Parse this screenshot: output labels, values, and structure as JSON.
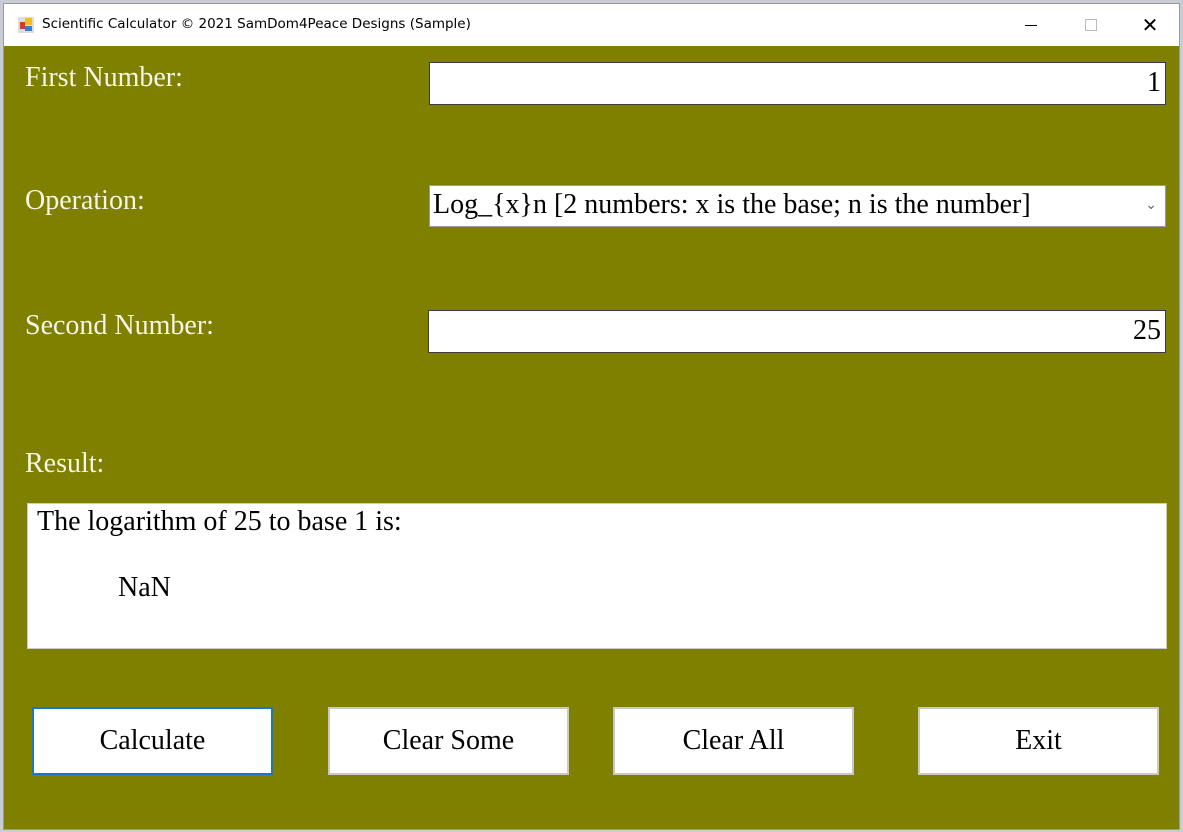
{
  "window": {
    "title": "Scientific Calculator © 2021 SamDom4Peace Designs (Sample)",
    "background": "#808000"
  },
  "form": {
    "first_label": "First Number:",
    "first_value": "1",
    "operation_label": "Operation:",
    "operation_value": "Log_{x}n [2 numbers: x is the base; n is the number]",
    "second_label": "Second Number:",
    "second_value": "25",
    "result_label": "Result:",
    "result_line1": "The logarithm of 25 to base 1 is:",
    "result_line2": "NaN"
  },
  "buttons": {
    "calculate": "Calculate",
    "clear_some": "Clear Some",
    "clear_all": "Clear All",
    "exit": "Exit"
  }
}
